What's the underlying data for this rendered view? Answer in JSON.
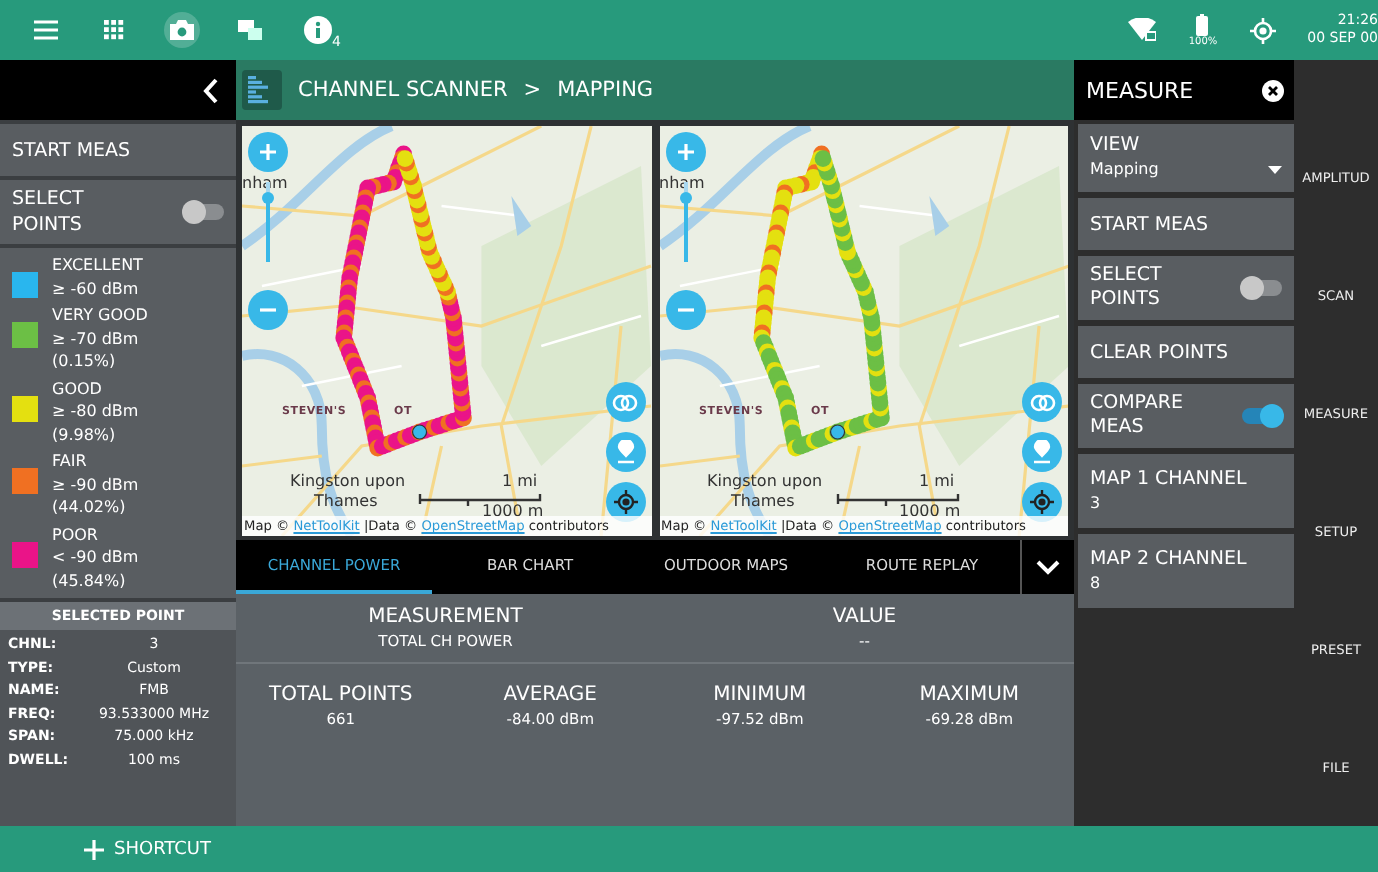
{
  "status_bar": {
    "info_count": "4",
    "battery": "100%",
    "time": "21:26",
    "date": "00 SEP 00"
  },
  "breadcrumb": {
    "title": "CHANNEL SCANNER",
    "separator": ">",
    "page": "MAPPING"
  },
  "sidebar": {
    "start_button": "START MEAS",
    "select_points": {
      "label": "SELECT POINTS",
      "on": false
    },
    "legend": [
      {
        "label": "EXCELLENT",
        "threshold": "≥ -60 dBm",
        "color": "#29b6ee"
      },
      {
        "label": "VERY GOOD",
        "threshold": "≥ -70 dBm",
        "share": "(0.15%)",
        "color": "#6cbf45"
      },
      {
        "label": "GOOD",
        "threshold": "≥ -80 dBm",
        "share": "(9.98%)",
        "color": "#e4e010"
      },
      {
        "label": "FAIR",
        "threshold": "≥ -90 dBm",
        "share": "(44.02%)",
        "color": "#f07022"
      },
      {
        "label": "POOR",
        "threshold": "< -90 dBm",
        "share": "(45.84%)",
        "color": "#ea1488"
      }
    ],
    "selected_point": {
      "title": "SELECTED POINT",
      "fields": [
        {
          "label": "CHNL:",
          "value": "3"
        },
        {
          "label": "TYPE:",
          "value": "Custom"
        },
        {
          "label": "NAME:",
          "value": "FMB"
        },
        {
          "label": "FREQ:",
          "value": "93.533000 MHz"
        },
        {
          "label": "SPAN:",
          "value": "75.000 kHz"
        },
        {
          "label": "DWELL:",
          "value": "100 ms"
        }
      ]
    }
  },
  "maps": [
    {
      "zoom_slider": {
        "level": 0.8
      },
      "town": "nham",
      "district_left": "STEVEN'S",
      "district_right": "OT",
      "city_line1": "Kingston upon",
      "city_line2": "Thames",
      "scale_imperial": "1 mi",
      "scale_metric": "1000 m",
      "attribution": {
        "prefix": "Map ©",
        "link1": "NetToolKit",
        "middle": "|Data ©",
        "link2": "OpenStreetMap",
        "suffix": "contributors"
      }
    },
    {
      "zoom_slider": {
        "level": 0.8
      },
      "town": "nham",
      "district_left": "STEVEN'S",
      "district_right": "OT",
      "city_line1": "Kingston upon",
      "city_line2": "Thames",
      "scale_imperial": "1 mi",
      "scale_metric": "1000 m",
      "attribution": {
        "prefix": "Map ©",
        "link1": "NetToolKit",
        "middle": "|Data ©",
        "link2": "OpenStreetMap",
        "suffix": "contributors"
      }
    }
  ],
  "tabs": [
    {
      "label": "CHANNEL POWER",
      "selected": true
    },
    {
      "label": "BAR CHART",
      "selected": false
    },
    {
      "label": "OUTDOOR MAPS",
      "selected": false
    },
    {
      "label": "ROUTE REPLAY",
      "selected": false
    }
  ],
  "results": {
    "columns": [
      "MEASUREMENT",
      "VALUE"
    ],
    "rows": [
      [
        "TOTAL CH POWER",
        "--"
      ]
    ]
  },
  "stats": [
    {
      "label": "TOTAL POINTS",
      "value": "661"
    },
    {
      "label": "AVERAGE",
      "value": "-84.00 dBm"
    },
    {
      "label": "MINIMUM",
      "value": "-97.52 dBm"
    },
    {
      "label": "MAXIMUM",
      "value": "-69.28 dBm"
    }
  ],
  "measure_panel": {
    "title": "MEASURE",
    "items": [
      {
        "kind": "dropdown",
        "label": "VIEW",
        "value": "Mapping"
      },
      {
        "kind": "button",
        "label": "START MEAS"
      },
      {
        "kind": "toggle",
        "label": "SELECT POINTS",
        "on": false
      },
      {
        "kind": "button",
        "label": "CLEAR POINTS"
      },
      {
        "kind": "toggle",
        "label": "COMPARE MEAS",
        "on": true
      },
      {
        "kind": "value",
        "label": "MAP 1 CHANNEL",
        "value": "3"
      },
      {
        "kind": "value",
        "label": "MAP 2 CHANNEL",
        "value": "8"
      }
    ]
  },
  "softkeys": [
    "AMPLITUD",
    "SCAN",
    "MEASURE",
    "SETUP",
    "PRESET",
    "FILE"
  ],
  "shortcut": "SHORTCUT"
}
